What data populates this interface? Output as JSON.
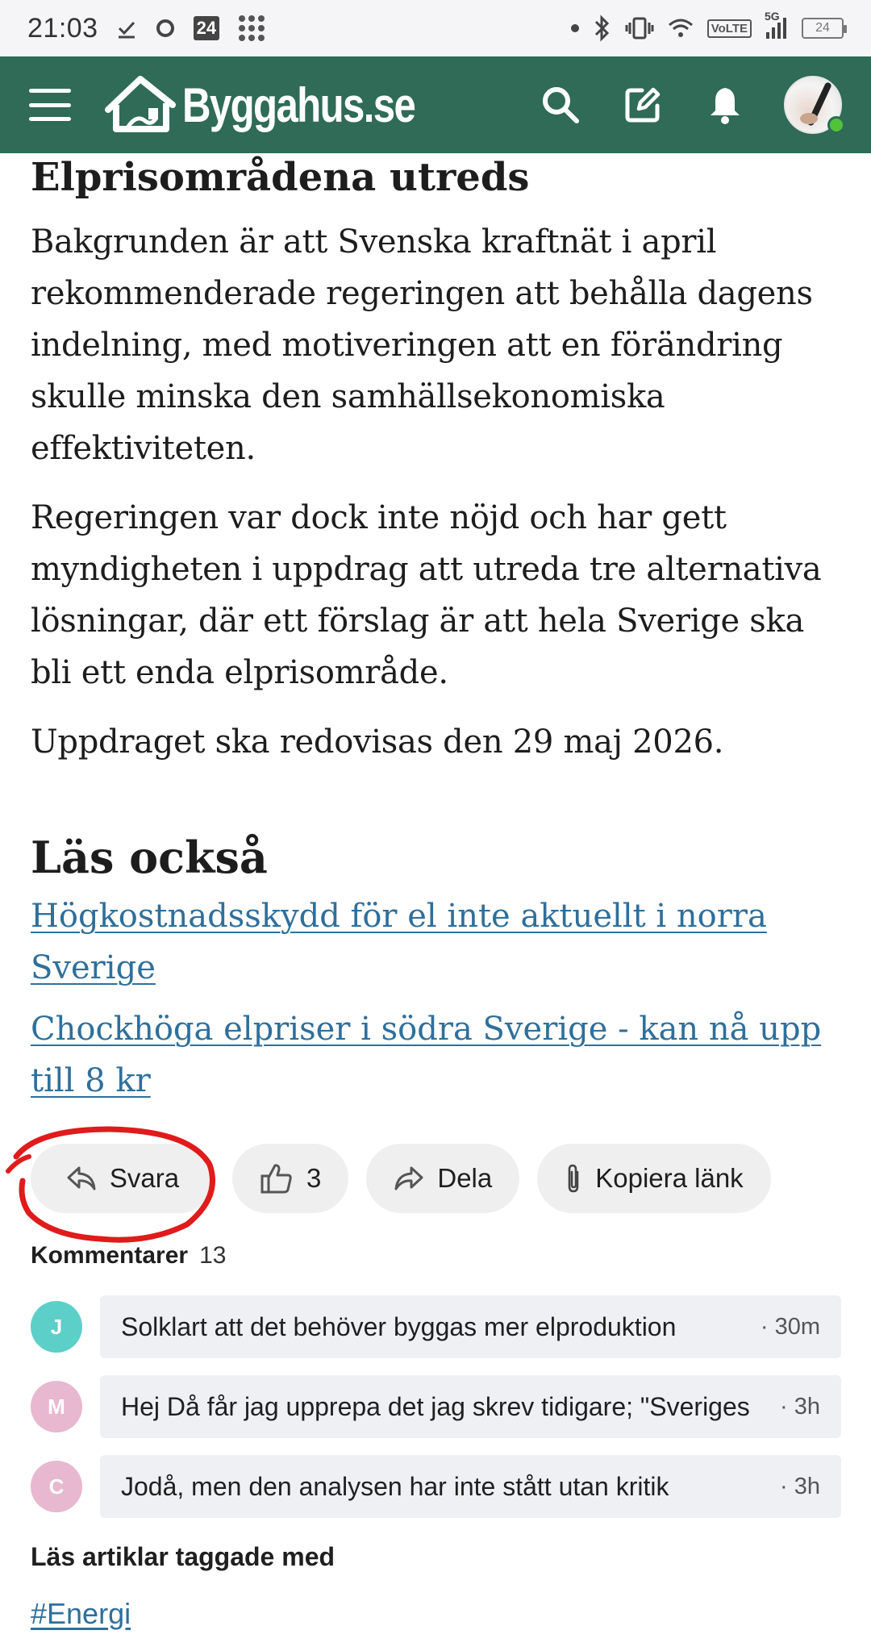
{
  "status_bar": {
    "time": "21:03",
    "badge_24": "24",
    "network": "VoLTE",
    "signal_label": "5G",
    "battery": "24",
    "icons": [
      "download-check-icon",
      "circle-icon",
      "calendar-24-icon",
      "apps-grid-icon",
      "dot-icon",
      "bluetooth-icon",
      "vibrate-icon",
      "wifi-icon",
      "volte-icon",
      "signal-icon",
      "battery-icon"
    ]
  },
  "app_bar": {
    "brand": "Byggahus.se",
    "background_color": "#2f6b57",
    "icons": [
      "menu-icon",
      "search-icon",
      "edit-icon",
      "bell-icon",
      "avatar"
    ]
  },
  "article": {
    "section_heading": "Elprisområdena utreds",
    "paragraphs": [
      "Bakgrunden är att Svenska kraftnät i april rekommenderade regeringen att behålla dagens indelning, med motiveringen att en förändring skulle minska den samhällsekonomiska effektiviteten.",
      "Regeringen var dock inte nöjd och har gett myndigheten i uppdrag att utreda tre alternativa lösningar, där ett förslag är att hela Sverige ska bli ett enda elprisområde.",
      "Uppdraget ska redovisas den 29 maj 2026."
    ],
    "read_also_heading": "Läs också",
    "read_also_links": [
      "Högkostnadsskydd för el inte aktuellt i norra Sverige",
      "Chockhöga elpriser i södra Sverige - kan nå upp till 8 kr"
    ],
    "link_color": "#2f6f9b"
  },
  "actions": {
    "reply_label": "Svara",
    "like_count": "3",
    "share_label": "Dela",
    "copy_link_label": "Kopiera länk",
    "highlight_color": "#e01b1b"
  },
  "comments": {
    "heading": "Kommentarer",
    "count": "13",
    "items": [
      {
        "initial": "J",
        "avatar_color": "#5ccfc9",
        "text": "Solklart att det behöver byggas mer elproduktion",
        "time": "· 30m"
      },
      {
        "initial": "M",
        "avatar_color": "#e7b8cf",
        "text": "Hej Då får jag upprepa det jag skrev tidigare; \"Sveriges",
        "time": "· 3h"
      },
      {
        "initial": "C",
        "avatar_color": "#e7b8cf",
        "text": "Jodå, men den analysen har inte stått utan kritik",
        "time": "· 3h"
      }
    ]
  },
  "tags": {
    "heading": "Läs artiklar taggade med",
    "items": [
      "#Energi"
    ]
  }
}
